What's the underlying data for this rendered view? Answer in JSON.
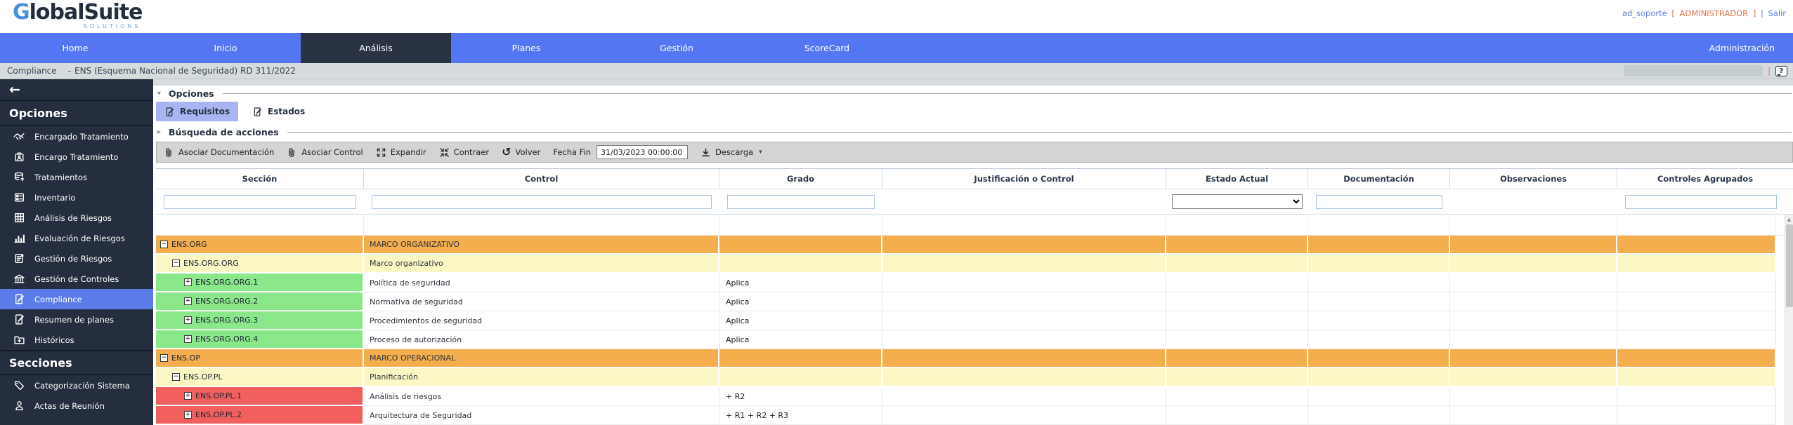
{
  "brand": {
    "g": "G",
    "rest": "lobalSuite",
    "subtitle": "SOLUTIONS"
  },
  "userbar": {
    "username": "ad_soporte",
    "bracket_open": "[",
    "role": "ADMINISTRADOR",
    "bracket_close": "]",
    "separator": "|",
    "logout": "Salir"
  },
  "nav": {
    "items": [
      {
        "label": "Home",
        "active": false
      },
      {
        "label": "Inicio",
        "active": false
      },
      {
        "label": "Análisis",
        "active": true
      },
      {
        "label": "Planes",
        "active": false
      },
      {
        "label": "Gestión",
        "active": false
      },
      {
        "label": "ScoreCard",
        "active": false
      }
    ],
    "right_item": "Administración"
  },
  "breadcrumb": {
    "module": "Compliance",
    "separator": "-",
    "title": "ENS (Esquema Nacional de Seguridad) RD 311/2022",
    "help_glyph": "?"
  },
  "glyphs": {
    "back": "←",
    "options_caret": "▾",
    "search_caret": "▸",
    "download_caret": "▾",
    "scroll_up": "▲",
    "expander_minus": "−",
    "expander_plus": "+"
  },
  "sidebar": {
    "sections": [
      {
        "heading": "Opciones",
        "items": [
          {
            "icon": "handshake-icon",
            "label": "Encargado Tratamiento",
            "selected": false
          },
          {
            "icon": "briefcase-icon",
            "label": "Encargo Tratamiento",
            "selected": false
          },
          {
            "icon": "database-icon",
            "label": "Tratamientos",
            "selected": false
          },
          {
            "icon": "inventory-icon",
            "label": "Inventario",
            "selected": false
          },
          {
            "icon": "grid-icon",
            "label": "Análisis de Riesgos",
            "selected": false
          },
          {
            "icon": "bar-chart-icon",
            "label": "Evaluación de Riesgos",
            "selected": false
          },
          {
            "icon": "document-icon",
            "label": "Gestión de Riesgos",
            "selected": false
          },
          {
            "icon": "bank-icon",
            "label": "Gestión de Controles",
            "selected": false
          },
          {
            "icon": "doc-pencil-icon",
            "label": "Compliance",
            "selected": true
          },
          {
            "icon": "doc-pencil-icon",
            "label": "Resumen de planes",
            "selected": false
          },
          {
            "icon": "folder-plus-icon",
            "label": "Históricos",
            "selected": false
          }
        ]
      },
      {
        "heading": "Secciones",
        "items": [
          {
            "icon": "tag-icon",
            "label": "Categorización Sistema",
            "selected": false
          },
          {
            "icon": "person-icon",
            "label": "Actas de Reunión",
            "selected": false
          }
        ]
      }
    ]
  },
  "main": {
    "options_panel": {
      "label": "Opciones"
    },
    "tabs": [
      {
        "icon": "doc-pencil-icon",
        "label": "Requisitos",
        "selected": true
      },
      {
        "icon": "doc-pencil-icon",
        "label": "Estados",
        "selected": false
      }
    ],
    "search_panel": {
      "label": "Búsqueda de acciones"
    },
    "toolbar": {
      "buttons": [
        {
          "icon": "paperclip-icon",
          "label": "Asociar Documentación"
        },
        {
          "icon": "paperclip-icon",
          "label": "Asociar Control"
        },
        {
          "icon": "expand-icon",
          "label": "Expandir"
        },
        {
          "icon": "contract-icon",
          "label": "Contraer"
        },
        {
          "icon": "undo-icon",
          "label": "Volver"
        }
      ],
      "fecha_fin_label": "Fecha Fin",
      "fecha_fin_value": "31/03/2023 00:00:00",
      "download": {
        "icon": "download-icon",
        "label": "Descarga"
      }
    },
    "table": {
      "columns": [
        {
          "label": "Sección",
          "filter": "input"
        },
        {
          "label": "Control",
          "filter": "input"
        },
        {
          "label": "Grado",
          "filter": "input"
        },
        {
          "label": "Justificación o Control",
          "filter": "none"
        },
        {
          "label": "Estado Actual",
          "filter": "select"
        },
        {
          "label": "Documentación",
          "filter": "input"
        },
        {
          "label": "Observaciones",
          "filter": "none"
        },
        {
          "label": "Controles Agrupados",
          "filter": "input"
        }
      ],
      "rows": [
        {
          "seccion": "ENS.ORG",
          "control": "MARCO ORGANIZATIVO",
          "grado": "",
          "level": 0,
          "expander": "minus",
          "type": "group-orange"
        },
        {
          "seccion": "ENS.ORG.ORG",
          "control": "Marco organizativo",
          "grado": "",
          "level": 1,
          "expander": "minus",
          "type": "group-yellow"
        },
        {
          "seccion": "ENS.ORG.ORG.1",
          "control": "Política de seguridad",
          "grado": "Aplica",
          "level": 2,
          "expander": "plus",
          "type": "leaf-green"
        },
        {
          "seccion": "ENS.ORG.ORG.2",
          "control": "Normativa de seguridad",
          "grado": "Aplica",
          "level": 2,
          "expander": "plus",
          "type": "leaf-green"
        },
        {
          "seccion": "ENS.ORG.ORG.3",
          "control": "Procedimientos de seguridad",
          "grado": "Aplica",
          "level": 2,
          "expander": "plus",
          "type": "leaf-green"
        },
        {
          "seccion": "ENS.ORG.ORG.4",
          "control": "Proceso de autorización",
          "grado": "Aplica",
          "level": 2,
          "expander": "plus",
          "type": "leaf-green"
        },
        {
          "seccion": "ENS.OP",
          "control": "MARCO OPERACIONAL",
          "grado": "",
          "level": 0,
          "expander": "minus",
          "type": "group-orange"
        },
        {
          "seccion": "ENS.OP.PL",
          "control": "Planificación",
          "grado": "",
          "level": 1,
          "expander": "minus",
          "type": "group-yellow"
        },
        {
          "seccion": "ENS.OP.PL.1",
          "control": "Análisis de riesgos",
          "grado": "+ R2",
          "level": 2,
          "expander": "plus",
          "type": "leaf-red"
        },
        {
          "seccion": "ENS.OP.PL.2",
          "control": "Arquitectura de Seguridad",
          "grado": "+ R1 + R2 + R3",
          "level": 2,
          "expander": "plus",
          "type": "leaf-red"
        }
      ]
    }
  },
  "colors": {
    "nav_blue": "#5576f2",
    "nav_active": "#2a3342",
    "sidebar_bg": "#252e3e",
    "selected_blue": "#5b7be8",
    "tab_selected": "#a9b4f2",
    "breadcrumb_bg": "#d6dbdd",
    "toolbar_bg": "#d4d4d4",
    "group_orange": "#f5ae4d",
    "group_yellow": "#fcf8c5",
    "leaf_green": "#8ae88a",
    "leaf_red": "#f15f5f",
    "link_blue": "#5b7be8",
    "role_orange": "#e8734a"
  }
}
